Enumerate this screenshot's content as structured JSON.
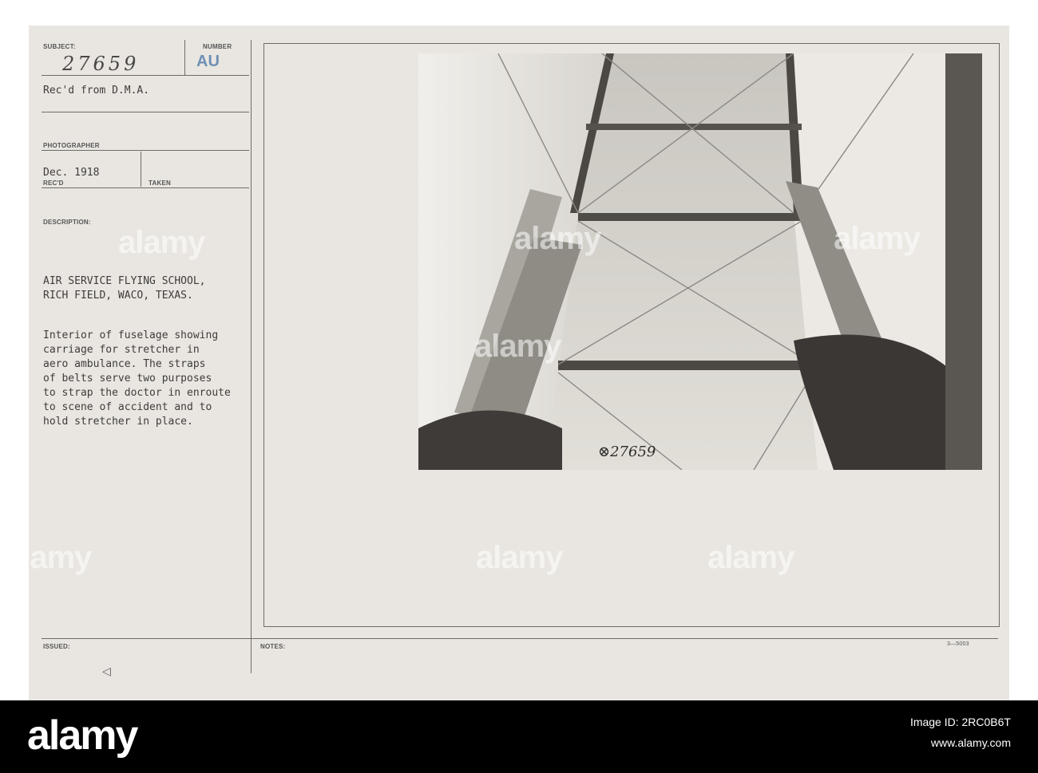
{
  "card": {
    "subject_label": "SUBJECT:",
    "number_label": "NUMBER",
    "subject_number": "27659",
    "number_stamp": "AU",
    "received_from": "Rec'd from D.M.A.",
    "photographer_label": "PHOTOGRAPHER",
    "date": "Dec. 1918",
    "recd_label": "REC'D",
    "taken_label": "TAKEN",
    "description_label": "DESCRIPTION:",
    "location_line1": "AIR SERVICE FLYING SCHOOL,",
    "location_line2": "RICH FIELD, WACO, TEXAS.",
    "description_lines": [
      "Interior of fuselage showing",
      "carriage for stretcher in",
      "aero ambulance. The straps",
      "of belts serve two purposes",
      "to strap the doctor in enroute",
      "to scene of accident and to",
      "hold stretcher in place."
    ],
    "issued_label": "ISSUED:",
    "notes_label": "NOTES:",
    "form_code": "3—5003",
    "photo_caption": "⊗27659"
  },
  "watermark": "alamy",
  "footer": {
    "brand": "alamy",
    "image_id_line": "Image ID: 2RC0B6T",
    "url": "www.alamy.com"
  }
}
